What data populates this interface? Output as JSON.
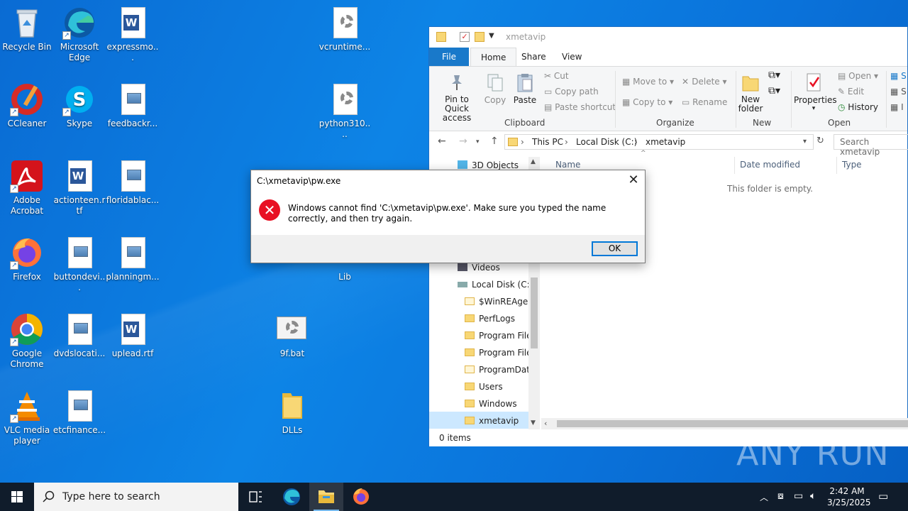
{
  "desktop": {
    "icons": [
      {
        "label": "Recycle Bin",
        "icon": "recycle-bin-icon"
      },
      {
        "label": "Microsoft Edge",
        "icon": "edge-icon"
      },
      {
        "label": "expressmo...",
        "icon": "word-doc-icon"
      },
      {
        "label": "vcruntime...",
        "icon": "system-file-icon"
      },
      {
        "label": "CCleaner",
        "icon": "ccleaner-icon"
      },
      {
        "label": "Skype",
        "icon": "skype-icon"
      },
      {
        "label": "feedbackr...",
        "icon": "image-file-icon"
      },
      {
        "label": "python310....",
        "icon": "system-file-icon"
      },
      {
        "label": "Adobe Acrobat",
        "icon": "acrobat-icon"
      },
      {
        "label": "actionteen.rtf",
        "icon": "word-doc-icon"
      },
      {
        "label": "floridablac...",
        "icon": "image-file-icon"
      },
      {
        "label": "Firefox",
        "icon": "firefox-icon"
      },
      {
        "label": "buttondevi...",
        "icon": "image-file-icon"
      },
      {
        "label": "planningm...",
        "icon": "image-file-icon"
      },
      {
        "label": "Lib",
        "icon": "folder-icon"
      },
      {
        "label": "Google Chrome",
        "icon": "chrome-icon"
      },
      {
        "label": "dvdslocati...",
        "icon": "image-file-icon"
      },
      {
        "label": "uplead.rtf",
        "icon": "word-doc-icon"
      },
      {
        "label": "9f.bat",
        "icon": "batch-file-icon"
      },
      {
        "label": "VLC media player",
        "icon": "vlc-icon"
      },
      {
        "label": "etcfinance...",
        "icon": "image-file-icon"
      },
      {
        "label": "DLLs",
        "icon": "folder-icon"
      }
    ]
  },
  "explorer": {
    "title": "xmetavip",
    "tabs": [
      "File",
      "Home",
      "Share",
      "View"
    ],
    "ribbon": {
      "clipboard": {
        "pin": "Pin to Quick access",
        "copy": "Copy",
        "paste": "Paste",
        "cut": "Cut",
        "copy_path": "Copy path",
        "paste_shortcut": "Paste shortcut",
        "group": "Clipboard"
      },
      "organize": {
        "move_to": "Move to",
        "copy_to": "Copy to",
        "delete": "Delete",
        "rename": "Rename",
        "group": "Organize"
      },
      "new": {
        "new_folder": "New folder",
        "group": "New"
      },
      "open": {
        "properties": "Properties",
        "open": "Open",
        "edit": "Edit",
        "history": "History",
        "group": "Open"
      }
    },
    "address": {
      "parts": [
        "This PC",
        "Local Disk (C:)",
        "xmetavip"
      ],
      "search_placeholder": "Search xmetavip"
    },
    "nav": {
      "top_item": "3D Objects",
      "items": [
        "Videos",
        "Local Disk (C:)",
        "$WinREAgent",
        "PerfLogs",
        "Program Files",
        "Program Files",
        "ProgramData",
        "Users",
        "Windows",
        "xmetavip"
      ]
    },
    "columns": [
      "Name",
      "Date modified",
      "Type"
    ],
    "empty_message": "This folder is empty.",
    "status": "0 items"
  },
  "dialog": {
    "title": "C:\\xmetavip\\pw.exe",
    "message": "Windows cannot find 'C:\\xmetavip\\pw.exe'. Make sure you typed the name correctly, and then try again.",
    "ok_label": "OK"
  },
  "taskbar": {
    "search_placeholder": "Type here to search",
    "time": "2:42 AM",
    "date": "3/25/2025"
  },
  "watermark": "ANY RUN",
  "colors": {
    "accent": "#0078d7",
    "error": "#e81123",
    "taskbar": "#101c2b",
    "file_tab": "#1979ca"
  }
}
